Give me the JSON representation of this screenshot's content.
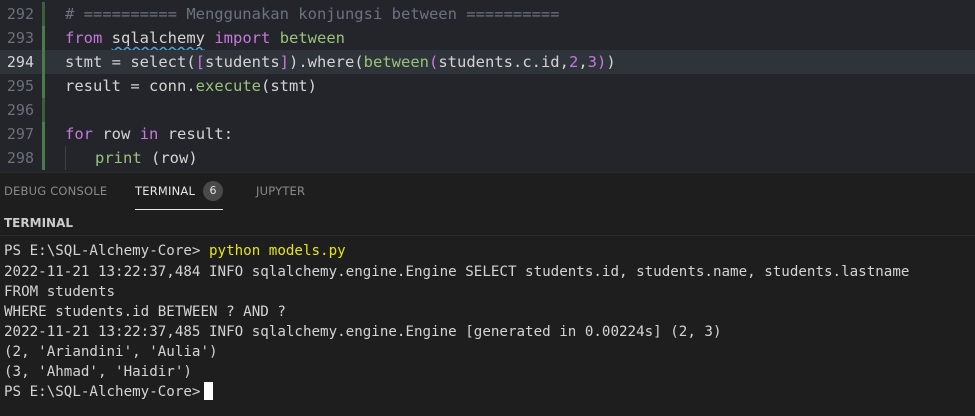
{
  "editor": {
    "lines": [
      {
        "num": "292",
        "text": "# ========== Menggunakan konjungsi between =========="
      },
      {
        "num": "293",
        "tokens": [
          "from",
          "sqlalchemy",
          "import",
          "between"
        ]
      },
      {
        "num": "294",
        "tokens": [
          "stmt = select(",
          "[",
          "students",
          "]",
          ").where(",
          "between",
          "(",
          "students.c.id,",
          "2",
          ",",
          "3",
          ")",
          ")"
        ]
      },
      {
        "num": "295",
        "tokens": [
          "result = conn.",
          "execute",
          "(stmt)"
        ]
      },
      {
        "num": "296",
        "text": ""
      },
      {
        "num": "297",
        "tokens": [
          "for",
          "row",
          "in",
          "result:"
        ]
      },
      {
        "num": "298",
        "tokens": [
          "print",
          "(row)"
        ]
      }
    ]
  },
  "panel": {
    "tabs": [
      {
        "label": "DEBUG CONSOLE"
      },
      {
        "label": "TERMINAL",
        "badge": "6"
      },
      {
        "label": "JUPYTER"
      }
    ],
    "section_title": "TERMINAL"
  },
  "terminal": {
    "prompt": "PS E:\\SQL-Alchemy-Core>",
    "command": "python models.py",
    "output": [
      "2022-11-21 13:22:37,484 INFO sqlalchemy.engine.Engine SELECT students.id, students.name, students.lastname",
      "FROM students",
      "WHERE students.id BETWEEN ? AND ?",
      "2022-11-21 13:22:37,485 INFO sqlalchemy.engine.Engine [generated in 0.00224s] (2, 3)",
      "(2, 'Ariandini', 'Aulia')",
      "(3, 'Ahmad', 'Haidir')"
    ],
    "final_prompt": "PS E:\\SQL-Alchemy-Core>"
  }
}
